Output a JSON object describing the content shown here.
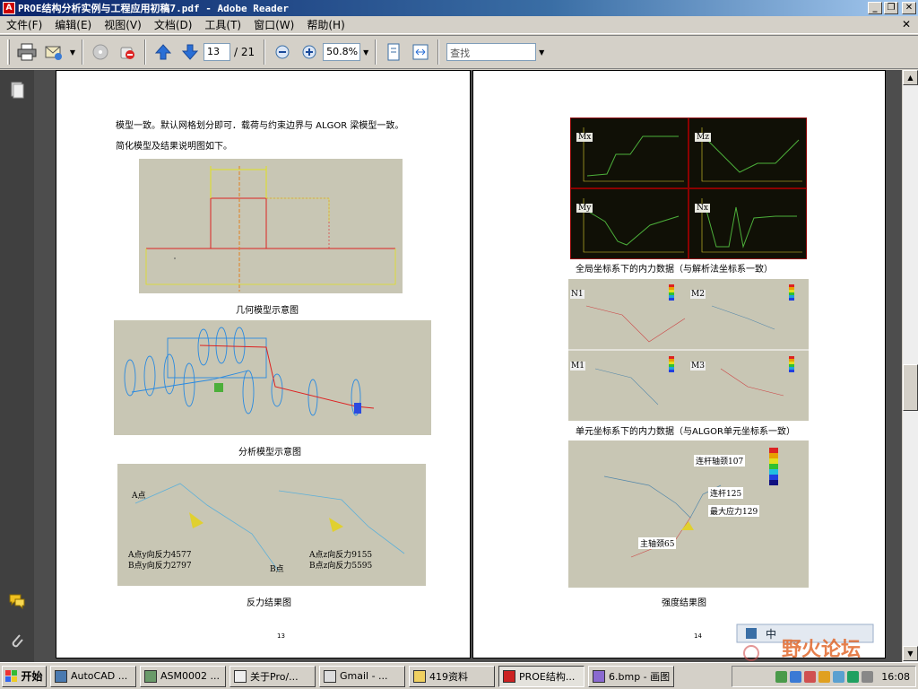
{
  "window": {
    "title": "PROE结构分析实例与工程应用初稿7.pdf - Adobe Reader"
  },
  "menu": [
    "文件(F)",
    "编辑(E)",
    "视图(V)",
    "文档(D)",
    "工具(T)",
    "窗口(W)",
    "帮助(H)"
  ],
  "toolbar": {
    "page_current": "13",
    "page_total": "/ 21",
    "zoom": "50.8%",
    "search_placeholder": "查找"
  },
  "left_page": {
    "line1": "模型一致。默认网格划分即可．载荷与约束边界与 ALGOR 梁模型一致。",
    "line2": "简化模型及结果说明图如下。",
    "captions": [
      "几何模型示意图",
      "分析模型示意图",
      "反力结果图"
    ],
    "reaction_labels": {
      "a_point": "A点",
      "b_point": "B点",
      "left_text1": "A点y向反力4577",
      "left_text2": "B点y向反力2797",
      "right_text1": "A点z向反力9155",
      "right_text2": "B点z向反力5595"
    },
    "page_number": "13"
  },
  "right_page": {
    "panel_labels": [
      "Mx",
      "Mz",
      "My",
      "Nx"
    ],
    "unit_labels": [
      "N1",
      "M2",
      "M1",
      "M3"
    ],
    "captions": [
      "全局坐标系下的内力数据（与解析法坐标系一致）",
      "单元坐标系下的内力数据（与ALGOR单元坐标系一致）",
      "强度结果图"
    ],
    "stress_labels": [
      "连杆轴颈107",
      "连杆125",
      "最大应力129",
      "主轴颈65"
    ],
    "page_number": "14"
  },
  "taskbar": {
    "start": "开始",
    "tasks": [
      "AutoCAD ...",
      "ASM0002 ...",
      "关于Pro/...",
      "Gmail - ...",
      "419资料",
      "PROE结构...",
      "6.bmp - 画图"
    ],
    "clock": "16:08"
  },
  "watermark": {
    "text": "野火论坛",
    "ime": "中"
  }
}
